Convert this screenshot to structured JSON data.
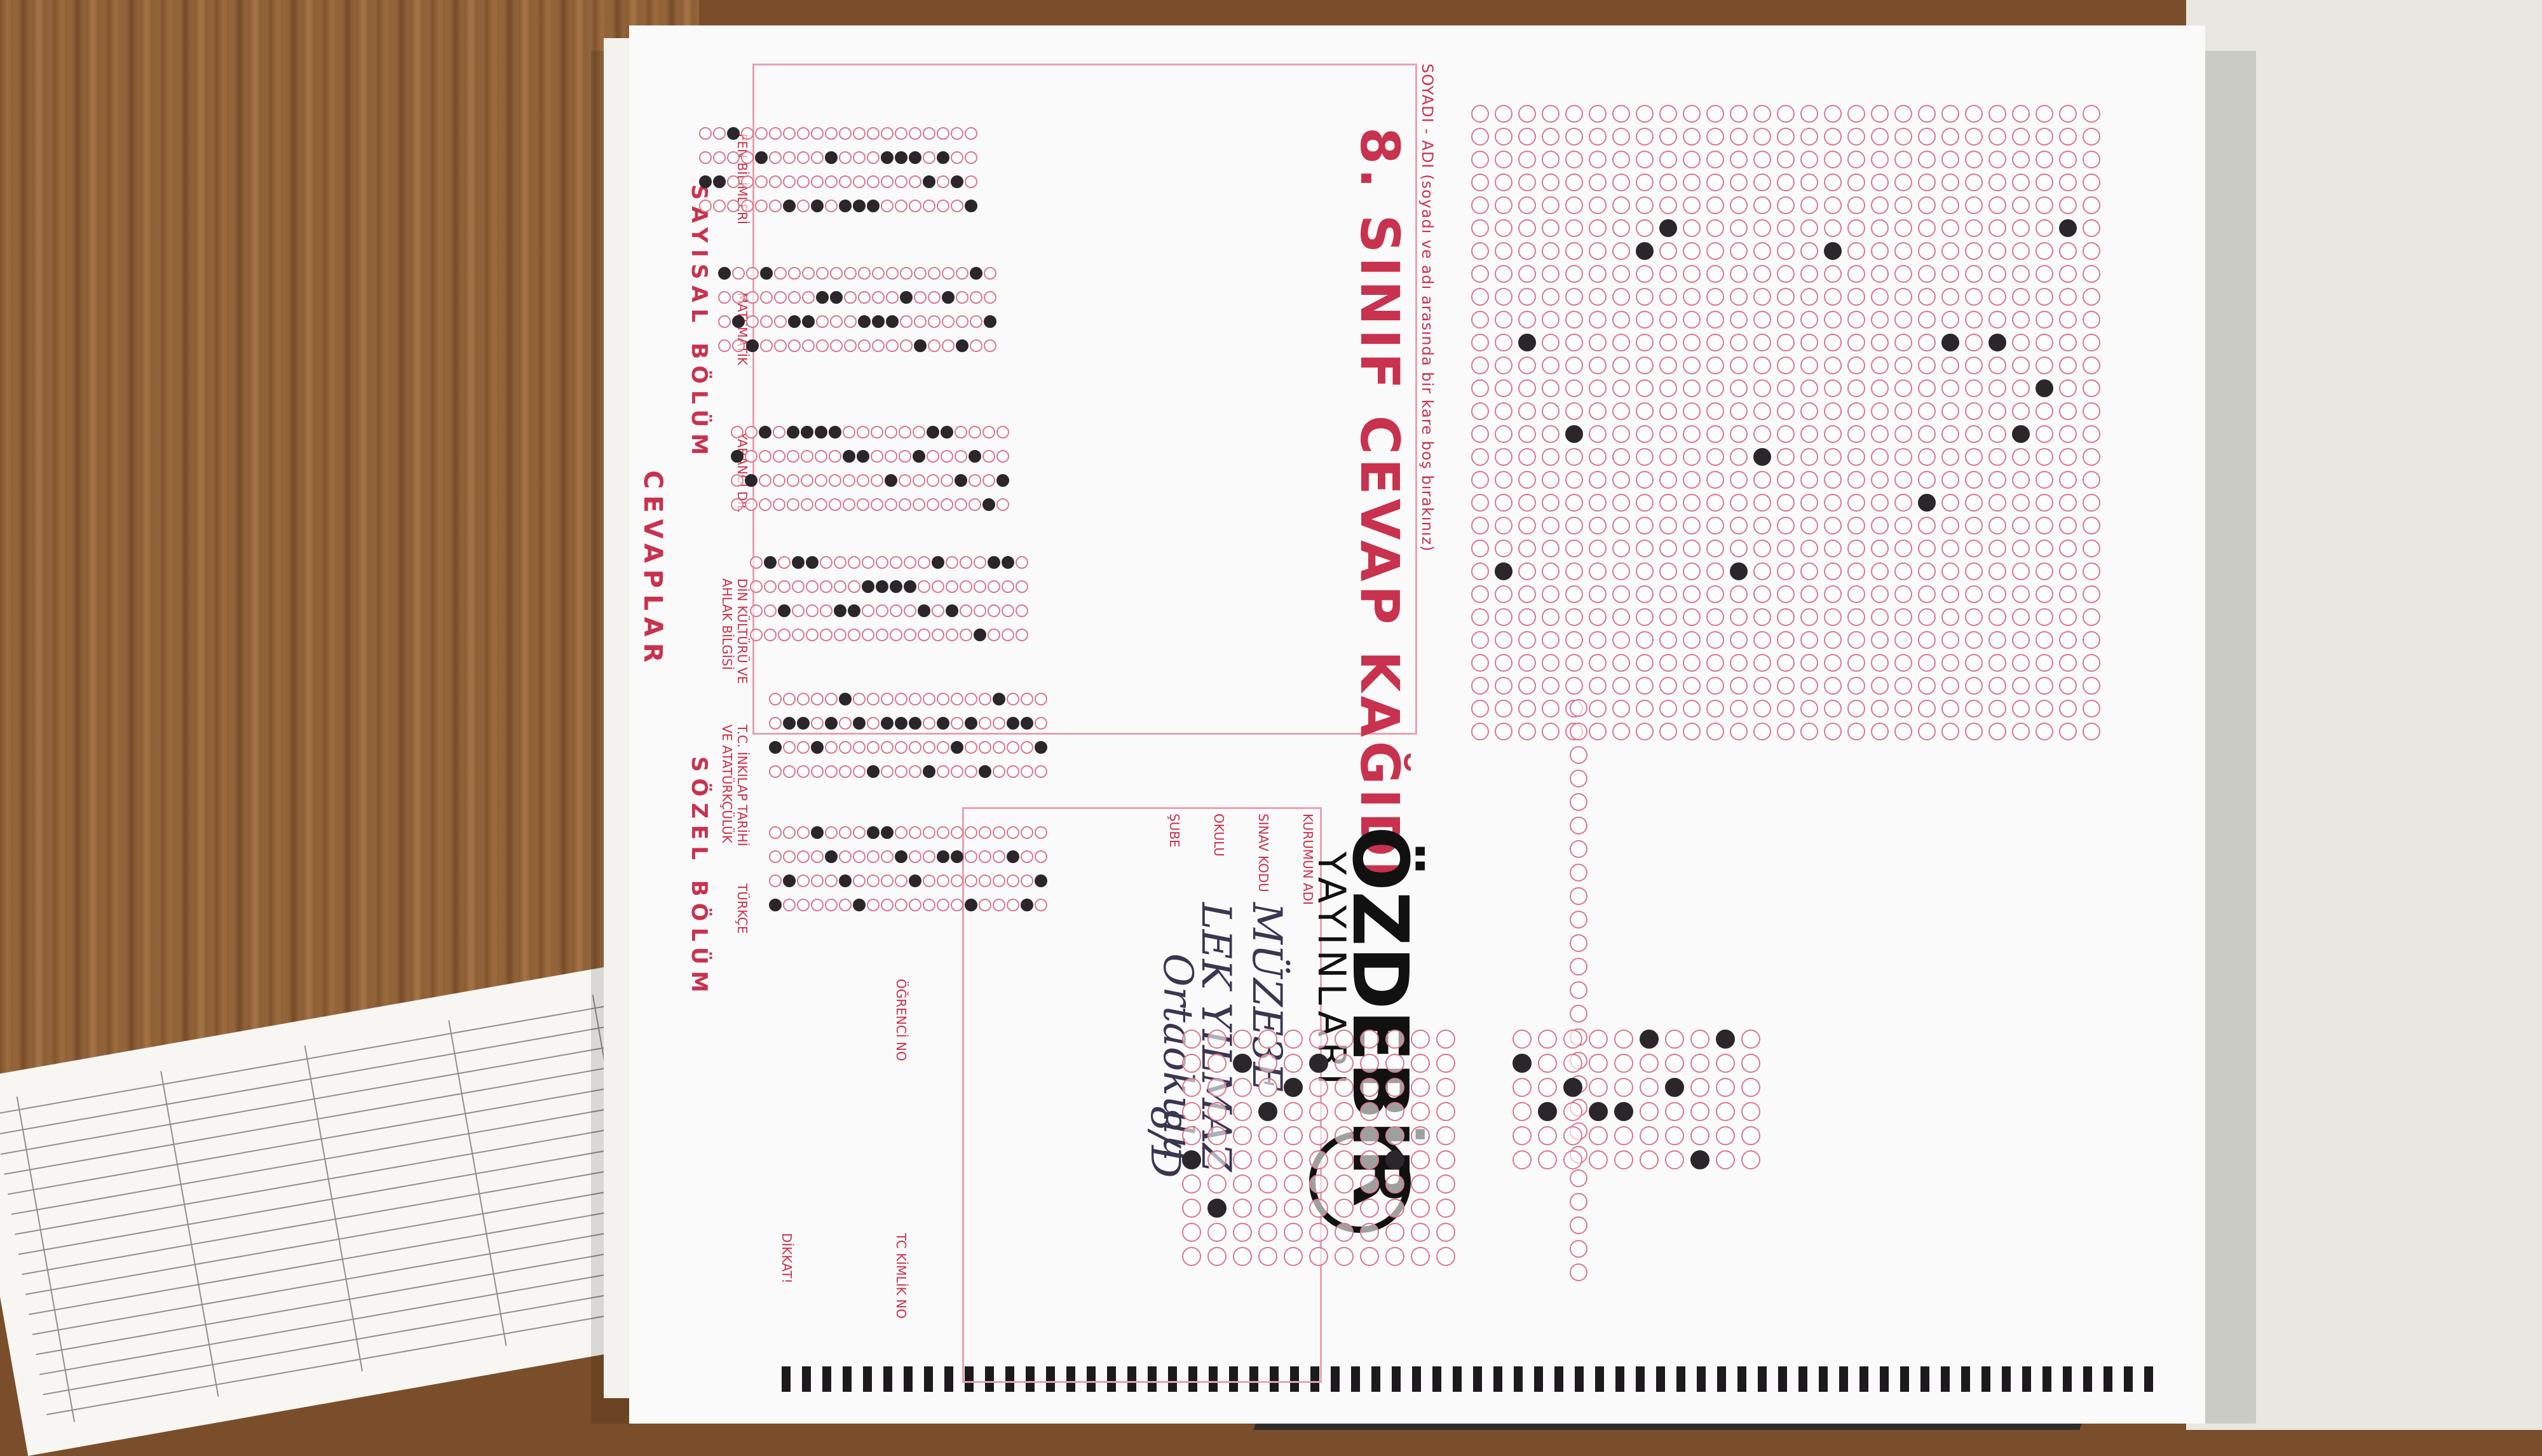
{
  "form": {
    "title": "8. SINIF CEVAP KAĞIDI",
    "brand": "ÖZDEBİR",
    "brand_sub": "YAYINLARI",
    "top_caption": "SOYADI - ADI  (soyadı ve adı arasında bir kare boş bırakınız)",
    "section_title": "CEVAPLAR",
    "sozel_title": "SÖZEL BÖLÜM",
    "sayisal_title": "SAYISAL BÖLÜM",
    "subjects": [
      "TÜRKÇE",
      "T.C. İNKILAP TARİHİ VE ATATÜRKÇÜLÜK",
      "DİN KÜLTÜRÜ VE AHLAK BİLGİSİ",
      "YABANCI DİL",
      "MATEMATİK",
      "FEN BİLİMLERİ"
    ],
    "info_labels": [
      "KURUMUN ADI",
      "SINAV KODU",
      "OKULU",
      "ŞUBE",
      "ÖĞRENCİ NO",
      "TC KİMLİK NO",
      "DİKKAT!"
    ],
    "handwriting": {
      "institution": "MÜZE3E",
      "name": "LEK YILMAZ",
      "school": "Ortaokulu",
      "class": "8/D"
    }
  },
  "colors": {
    "form_ink": "#c8324e",
    "bubble_outline": "#d8798c",
    "mark": "#2a2629",
    "wood": "#8a5a31"
  }
}
